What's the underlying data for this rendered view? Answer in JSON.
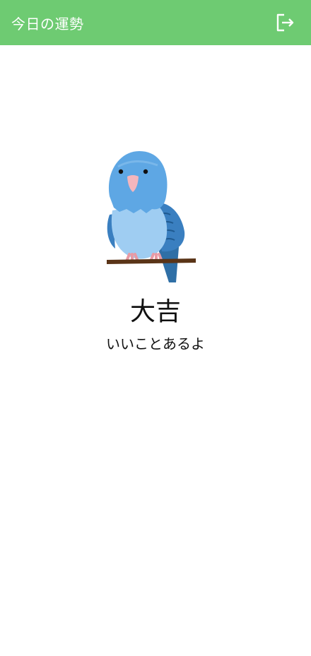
{
  "app_bar": {
    "title": "今日の運勢",
    "logout_icon": "logout-icon",
    "color": "#6ecb72"
  },
  "fortune": {
    "illustration": "parakeet-illustration",
    "result": "大吉",
    "message": "いいことあるよ"
  }
}
